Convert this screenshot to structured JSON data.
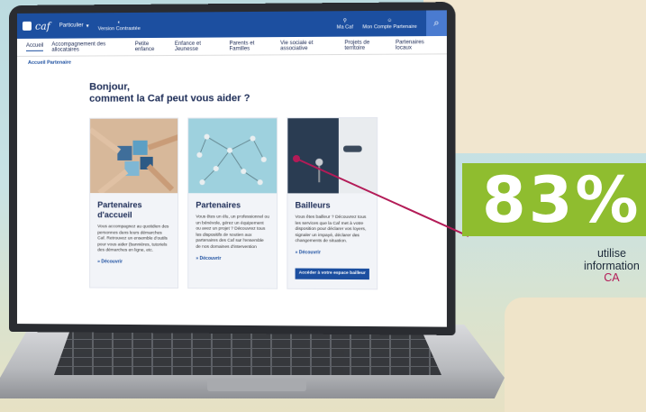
{
  "site": {
    "logo_text": "caf",
    "profile_label": "Particulier",
    "contrast_label": "Version Contrastée",
    "top_links": [
      {
        "label": "Ma Caf",
        "icon": "pin-icon"
      },
      {
        "label": "Mon Compte Partenaire",
        "icon": "user-icon"
      }
    ],
    "search_icon": "search-icon"
  },
  "nav": {
    "items": [
      "Accueil",
      "Accompagnement des allocataires",
      "Petite enfance",
      "Enfance et Jeunesse",
      "Parents et Familles",
      "Vie sociale et associative",
      "Projets de territoire",
      "Partenaires locaux"
    ]
  },
  "breadcrumb": "Accueil Partenaire",
  "hero": {
    "line1": "Bonjour,",
    "line2": "comment la Caf peut vous aider ?"
  },
  "cards": [
    {
      "title": "Partenaires d'accueil",
      "text": "Vous accompagnez au quotidien des personnes dans leurs démarches Caf. Retrouvez un ensemble d'outils pour vous aider (bannières, tutoriels des démarches en ligne, etc.",
      "link": "» Découvrir"
    },
    {
      "title": "Partenaires",
      "text": "Vous êtes un élu, un professionnel ou un bénévole, gérez un équipement ou avez un projet ? Découvrez tous les dispositifs de soutien aux partenaires des Caf sur l'ensemble de nos domaines d'intervention",
      "link": "» Découvrir"
    },
    {
      "title": "Bailleurs",
      "text": "Vous êtes bailleur ? Découvrez tous les services que la Caf met à votre disposition pour déclarer vos loyers, signaler un impayé, déclarer des changements de situation.",
      "link": "» Découvrir",
      "cta": "Accéder à votre espace bailleur"
    }
  ],
  "stat": {
    "value": "83%",
    "caption_line1": "utilise",
    "caption_line2": "information",
    "caption_line3": "CA"
  },
  "colors": {
    "caf_blue": "#1c4fa0",
    "badge_green": "#8fbd2f",
    "callout": "#b31b57"
  }
}
